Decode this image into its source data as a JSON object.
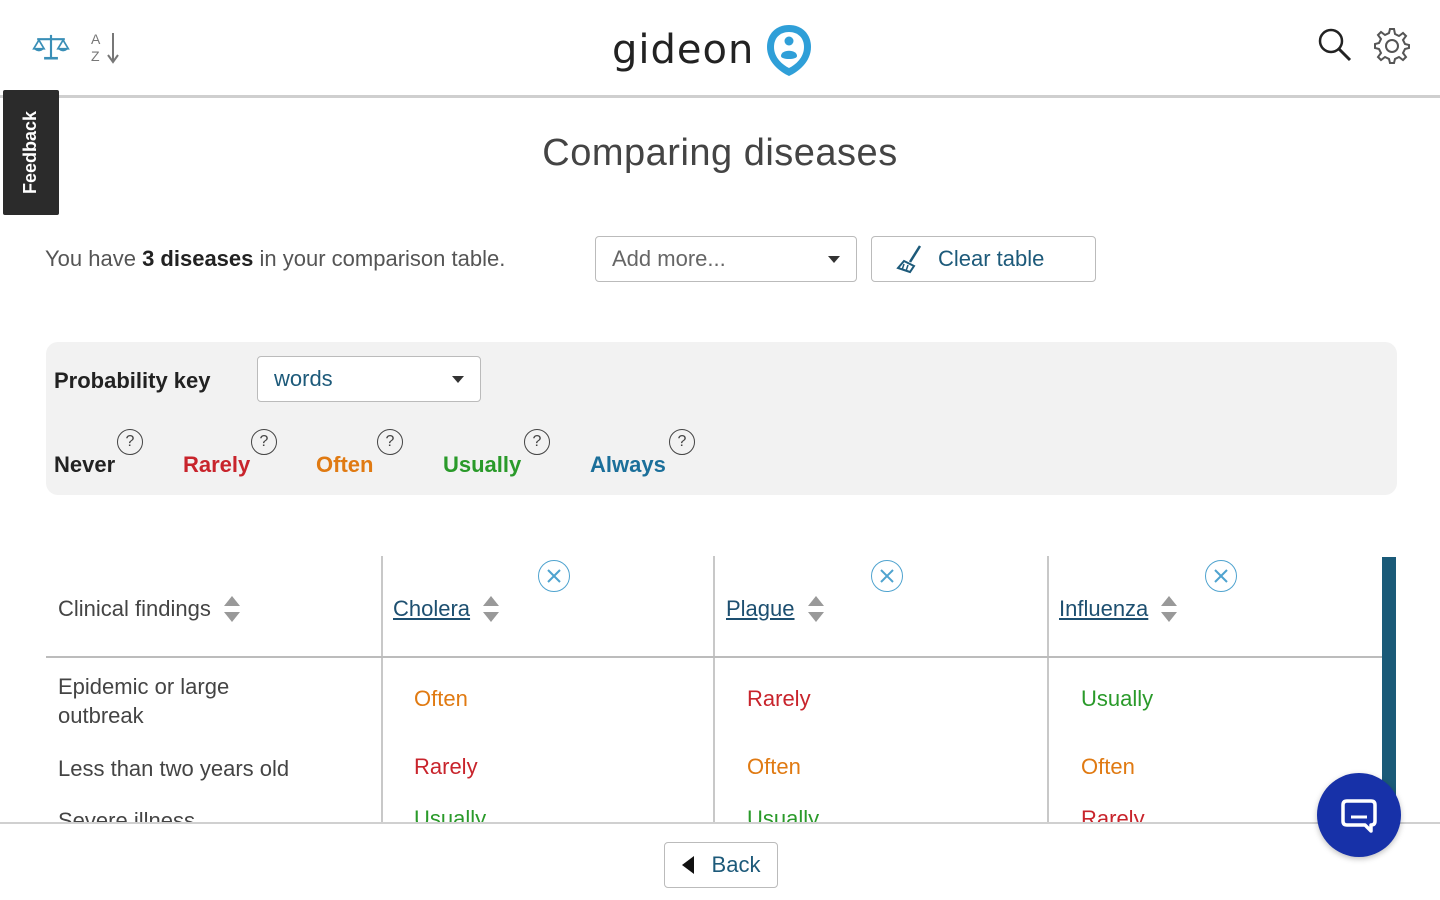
{
  "header": {
    "brand": "gideon",
    "left_icons": [
      "scale-icon",
      "sort-az-icon"
    ],
    "right_icons": [
      "search-icon",
      "gear-icon"
    ]
  },
  "feedback": {
    "label": "Feedback"
  },
  "page": {
    "title": "Comparing diseases"
  },
  "summary": {
    "prefix": "You have",
    "count_text": "3 diseases",
    "suffix": "in your comparison table."
  },
  "add_more": {
    "placeholder": "Add more..."
  },
  "clear_table": {
    "label": "Clear table"
  },
  "probability_key": {
    "label": "Probability key",
    "selected": "words",
    "levels": [
      "Never",
      "Rarely",
      "Often",
      "Usually",
      "Always"
    ]
  },
  "table": {
    "first_column_header": "Clinical findings",
    "diseases": [
      "Cholera",
      "Plague",
      "Influenza"
    ],
    "rows": [
      {
        "finding_lines": [
          "Epidemic or large",
          "outbreak"
        ],
        "values": [
          "Often",
          "Rarely",
          "Usually"
        ]
      },
      {
        "finding_lines": [
          "Less than two years old"
        ],
        "values": [
          "Rarely",
          "Often",
          "Often"
        ]
      },
      {
        "finding_lines": [
          "Severe illness"
        ],
        "values": [
          "Usually",
          "Usually",
          "Rarely"
        ]
      }
    ]
  },
  "footer": {
    "back_label": "Back"
  },
  "colors": {
    "never": "#222222",
    "rarely": "#c8242c",
    "often": "#e07a12",
    "usually": "#2a9a2a",
    "always": "#1b6f9a",
    "link": "#1d4f70",
    "chat_button": "#1731a8",
    "scrollbar": "#1a5a78"
  }
}
